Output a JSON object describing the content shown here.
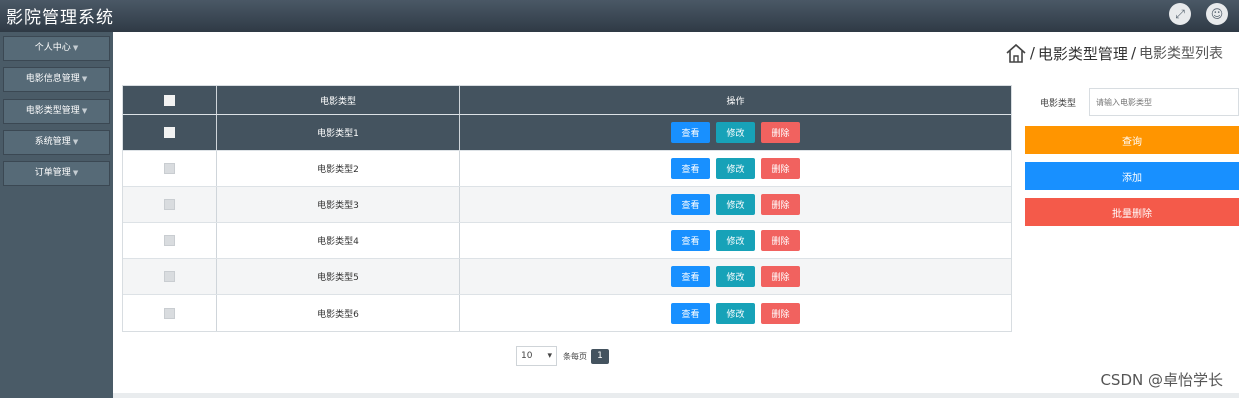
{
  "app": {
    "title": "影院管理系统"
  },
  "topbar": {
    "fullscreen_icon": "expand-icon",
    "user_icon": "user-icon"
  },
  "sidebar": {
    "items": [
      {
        "label": "个人中心"
      },
      {
        "label": "电影信息管理"
      },
      {
        "label": "电影类型管理"
      },
      {
        "label": "系统管理"
      },
      {
        "label": "订单管理"
      }
    ]
  },
  "breadcrumb": {
    "home_icon": "home-icon",
    "section": "电影类型管理",
    "current": "电影类型列表",
    "separator": "/"
  },
  "table": {
    "headers": {
      "name": "电影类型",
      "ops": "操作"
    },
    "rows": [
      {
        "name": "电影类型1"
      },
      {
        "name": "电影类型2"
      },
      {
        "name": "电影类型3"
      },
      {
        "name": "电影类型4"
      },
      {
        "name": "电影类型5"
      },
      {
        "name": "电影类型6"
      }
    ],
    "actions": {
      "view": "查看",
      "edit": "修改",
      "delete": "删除"
    }
  },
  "pagination": {
    "page_size": "10",
    "per_page_label": "条每页",
    "current_page": "1"
  },
  "search": {
    "label": "电影类型",
    "placeholder": "请输入电影类型",
    "query_button": "查询",
    "add_button": "添加",
    "batch_delete_button": "批量删除"
  },
  "watermark": "CSDN @卓怡学长",
  "colors": {
    "primary": "#1890ff",
    "info": "#17a2b8",
    "danger": "#f1625f",
    "warning": "#ff9500",
    "header": "#44535f"
  }
}
